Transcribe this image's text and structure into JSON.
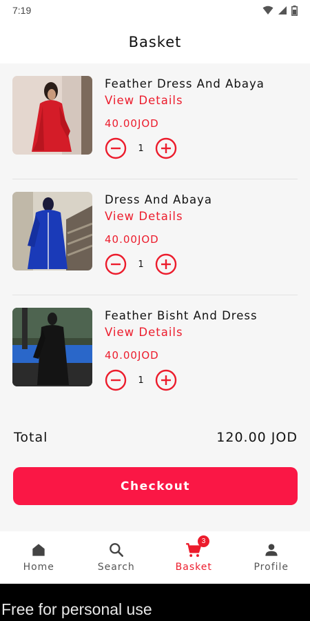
{
  "status_bar": {
    "time": "7:19"
  },
  "header": {
    "title": "Basket"
  },
  "items": [
    {
      "name": "Feather Dress And Abaya",
      "details_label": "View Details",
      "price": "40.00JOD",
      "quantity": "1"
    },
    {
      "name": "Dress And Abaya",
      "details_label": "View Details",
      "price": "40.00JOD",
      "quantity": "1"
    },
    {
      "name": "Feather Bisht And Dress",
      "details_label": "View Details",
      "price": "40.00JOD",
      "quantity": "1"
    }
  ],
  "total": {
    "label": "Total",
    "value": "120.00 JOD"
  },
  "checkout": {
    "label": "Checkout"
  },
  "nav": {
    "items": [
      {
        "label": "Home",
        "icon": "home-icon"
      },
      {
        "label": "Search",
        "icon": "search-icon"
      },
      {
        "label": "Basket",
        "icon": "cart-icon",
        "badge": "3",
        "active": true
      },
      {
        "label": "Profile",
        "icon": "person-icon"
      }
    ]
  },
  "watermark": {
    "text": "Free for personal use"
  },
  "colors": {
    "accent": "#ec1c2c",
    "button": "#fa1745"
  }
}
